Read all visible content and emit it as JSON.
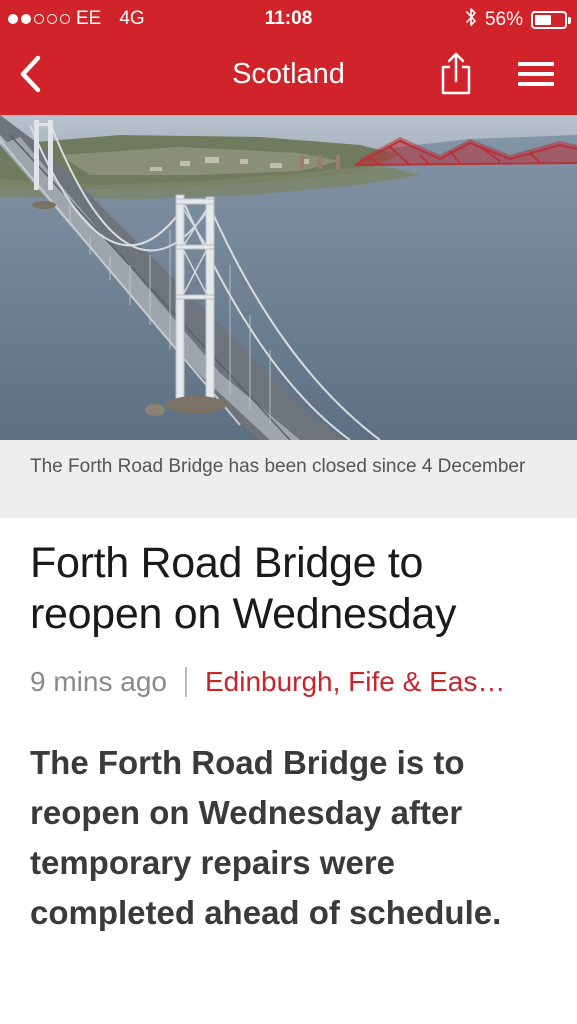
{
  "status_bar": {
    "signal_label": "",
    "carrier": "EE",
    "network": "4G",
    "time": "11:08",
    "battery_percent": "56%",
    "battery_level": 0.56,
    "bluetooth_icon": "bluetooth-icon",
    "signal_bars_filled": 2,
    "signal_bars_total": 5
  },
  "nav": {
    "title": "Scotland",
    "back_icon": "chevron-left-icon",
    "share_icon": "share-icon",
    "menu_icon": "hamburger-menu-icon"
  },
  "hero": {
    "caption": "The Forth Road Bridge has been closed since 4 December"
  },
  "article": {
    "headline": "Forth Road Bridge to reopen on Wednesday",
    "timestamp": "9 mins ago",
    "section": "Edinburgh, Fife & Eas…",
    "summary": "The Forth Road Bridge is to reopen on Wednesday after temporary repairs were completed ahead of schedule."
  },
  "colors": {
    "brand_red": "#d1232a",
    "link_red": "#c9252c",
    "caption_bg": "#eeeeee"
  }
}
